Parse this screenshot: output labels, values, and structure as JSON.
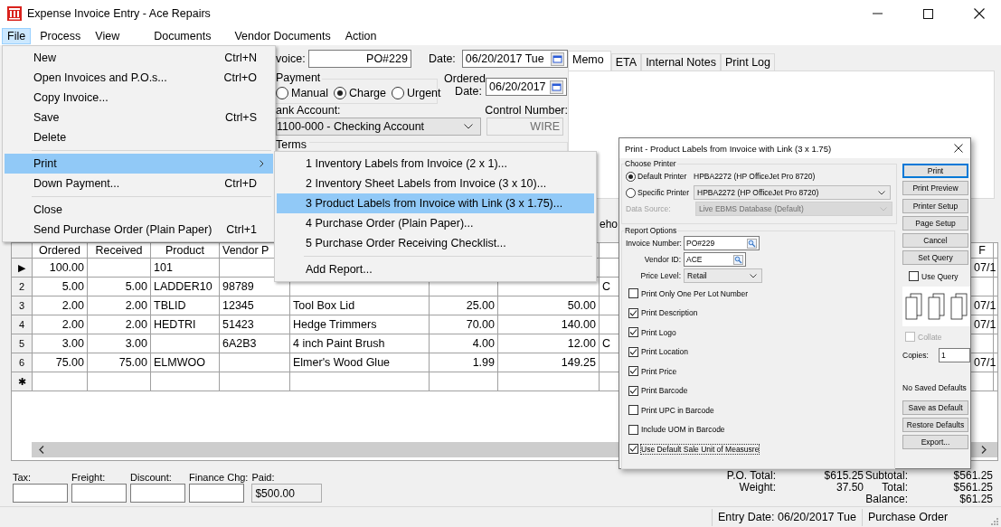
{
  "window": {
    "title": "Expense Invoice Entry - Ace Repairs"
  },
  "menu_bar": [
    {
      "label": "File",
      "selected": true
    },
    {
      "label": "Process",
      "selected": false
    },
    {
      "label": "View",
      "selected": false
    },
    {
      "label": "Documents",
      "selected": false
    },
    {
      "label": "Vendor Documents",
      "selected": false
    },
    {
      "label": "Action",
      "selected": false
    }
  ],
  "file_menu": [
    {
      "kind": "item",
      "label": "New",
      "shortcut": "Ctrl+N",
      "selected": false
    },
    {
      "kind": "item",
      "label": "Open Invoices and P.O.s...",
      "shortcut": "Ctrl+O",
      "selected": false
    },
    {
      "kind": "item",
      "label": "Copy Invoice...",
      "selected": false
    },
    {
      "kind": "item",
      "label": "Save",
      "shortcut": "Ctrl+S",
      "selected": false
    },
    {
      "kind": "item",
      "label": "Delete",
      "selected": false
    },
    {
      "kind": "separator"
    },
    {
      "kind": "submenu",
      "label": "Print",
      "selected": true
    },
    {
      "kind": "item",
      "label": "Down Payment...",
      "shortcut": "Ctrl+D",
      "selected": false
    },
    {
      "kind": "separator"
    },
    {
      "kind": "item",
      "label": "Close",
      "selected": false
    },
    {
      "kind": "item",
      "label": "Send Purchase Order (Plain Paper)",
      "shortcut": "Ctrl+1",
      "selected": false
    }
  ],
  "print_submenu": [
    {
      "kind": "item",
      "label": "1 Inventory Labels from Invoice (2 x 1)...",
      "selected": false
    },
    {
      "kind": "item",
      "label": "2 Inventory Sheet Labels from Invoice (3 x 10)...",
      "selected": false
    },
    {
      "kind": "item",
      "label": "3 Product Labels from Invoice with Link (3 x 1.75)...",
      "selected": true
    },
    {
      "kind": "item",
      "label": "4 Purchase Order (Plain Paper)...",
      "selected": false
    },
    {
      "kind": "item",
      "label": "5 Purchase Order Receiving Checklist...",
      "selected": false
    },
    {
      "kind": "separator"
    },
    {
      "kind": "item",
      "label": "Add Report...",
      "selected": false
    }
  ],
  "form": {
    "invoice_label": "voice:",
    "invoice": "PO#229",
    "date_label": "Date:",
    "date": "06/20/2017 Tue",
    "payment": {
      "label": "Payment",
      "options": [
        {
          "label": "Manual",
          "selected": false
        },
        {
          "label": "Charge",
          "selected": true
        },
        {
          "label": "Urgent",
          "selected": false
        }
      ]
    },
    "ordered_date_label": "Ordered Date:",
    "ordered_date": "06/20/2017",
    "bank_account_label": "ank Account:",
    "bank_account": "1100-000 - Checking Account",
    "control_number_label": "Control Number:",
    "control_number": "WIRE",
    "terms_label": "Terms"
  },
  "notes_tabs": [
    {
      "label": "Memo",
      "selected": true
    },
    {
      "label": "ETA",
      "selected": false
    },
    {
      "label": "Internal Notes",
      "selected": false
    },
    {
      "label": "Print Log",
      "selected": false
    }
  ],
  "lower_tab_fragment": "eho",
  "table": {
    "columns": [
      "Ordered",
      "Received",
      "Product",
      "Vendor P",
      null,
      null,
      null,
      null,
      "F"
    ],
    "rows": [
      {
        "marker": "▶",
        "cells": [
          "100.00",
          null,
          "101",
          null,
          null,
          null,
          null,
          null,
          "07/1"
        ]
      },
      {
        "marker": "2",
        "cells": [
          "5.00",
          "5.00",
          "LADDER10",
          "98789",
          null,
          null,
          null,
          "C",
          null
        ]
      },
      {
        "marker": "3",
        "cells": [
          "2.00",
          "2.00",
          "TBLID",
          "12345",
          "Tool Box Lid",
          "25.00",
          "50.00",
          null,
          "07/1"
        ]
      },
      {
        "marker": "4",
        "cells": [
          "2.00",
          "2.00",
          "HEDTRI",
          "51423",
          "Hedge Trimmers",
          "70.00",
          "140.00",
          null,
          "07/1"
        ]
      },
      {
        "marker": "5",
        "cells": [
          "3.00",
          "3.00",
          null,
          "6A2B3",
          "4 inch Paint Brush",
          "4.00",
          "12.00",
          "C",
          null
        ]
      },
      {
        "marker": "6",
        "cells": [
          "75.00",
          "75.00",
          "ELMWOO",
          null,
          "Elmer's Wood Glue",
          "1.99",
          "149.25",
          null,
          "07/1"
        ]
      },
      {
        "marker": "✱",
        "cells": [
          null,
          null,
          null,
          null,
          null,
          null,
          null,
          null,
          null
        ]
      }
    ]
  },
  "charge_fields": [
    {
      "label": "Tax:",
      "disabled": false
    },
    {
      "label": "Freight:",
      "disabled": false
    },
    {
      "label": "Discount:",
      "disabled": false
    },
    {
      "label": "Finance Chg:",
      "disabled": false
    },
    {
      "label": "Paid:",
      "value": "$500.00",
      "disabled": true
    }
  ],
  "totals": [
    {
      "left": {
        "label": "P.O. Total:",
        "value": "$615.25"
      },
      "right": {
        "label": "Subtotal:",
        "value": "$561.25"
      }
    },
    {
      "left": {
        "label": "Weight:",
        "value": "37.50"
      },
      "right": {
        "label": "Total:",
        "value": "$561.25"
      }
    },
    {
      "right": {
        "label": "Balance:",
        "value": "$61.25"
      }
    }
  ],
  "status_bar": [
    "Entry Date: 06/20/2017 Tue",
    "Purchase Order"
  ],
  "dialog": {
    "title": "Print - Product Labels from Invoice with Link (3 x 1.75)",
    "choose_printer": {
      "label": "Choose Printer",
      "default_printer": {
        "label": "Default Printer",
        "selected": true,
        "value": "HPBA2272 (HP OfficeJet Pro 8720)"
      },
      "specific_printer": {
        "label": "Specific Printer",
        "selected": false,
        "value": "HPBA2272 (HP OfficeJet Pro 8720)"
      },
      "data_source": {
        "label": "Data Source:",
        "value": "Live EBMS Database (Default)",
        "disabled": true
      }
    },
    "report_options": {
      "label": "Report Options",
      "invoice_number": {
        "label": "Invoice Number:",
        "value": "PO#229"
      },
      "vendor_id": {
        "label": "Vendor ID:",
        "value": "ACE"
      },
      "price_level": {
        "label": "Price Level:",
        "value": "Retail"
      },
      "checkboxes": [
        {
          "label": "Print Only One Per Lot Number",
          "checked": false,
          "focused": false
        },
        {
          "label": "Print Description",
          "checked": true,
          "focused": false
        },
        {
          "label": "Print Logo",
          "checked": true,
          "focused": false
        },
        {
          "label": "Print Location",
          "checked": true,
          "focused": false
        },
        {
          "label": "Print Price",
          "checked": true,
          "focused": false
        },
        {
          "label": "Print Barcode",
          "checked": true,
          "focused": false
        },
        {
          "label": "Print UPC in Barcode",
          "checked": false,
          "focused": false
        },
        {
          "label": "Include UOM in Barcode",
          "checked": false,
          "focused": false
        },
        {
          "label": "Use Default Sale Unit of Measusre",
          "checked": true,
          "focused": true
        }
      ]
    },
    "buttons": [
      {
        "label": "Print",
        "default": true
      },
      {
        "label": "Print Preview",
        "default": false
      },
      {
        "label": "Printer Setup",
        "default": false
      },
      {
        "label": "Page Setup",
        "default": false
      },
      {
        "label": "Cancel",
        "default": false
      },
      {
        "label": "Set Query",
        "default": false
      }
    ],
    "use_query": {
      "label": "Use Query",
      "checked": false
    },
    "collate": {
      "label": "Collate",
      "checked": false,
      "disabled": true
    },
    "copies": {
      "label": "Copies:",
      "value": "1"
    },
    "defaults_status": "No Saved Defaults",
    "lower_buttons": [
      "Save as Default",
      "Restore Defaults",
      "Export..."
    ]
  }
}
